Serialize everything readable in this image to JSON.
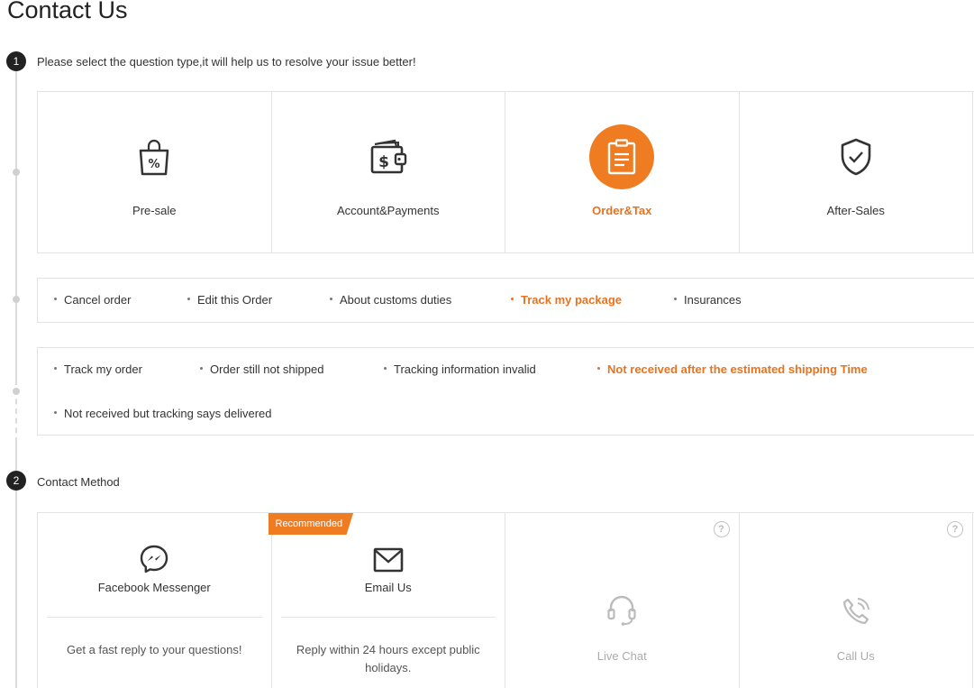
{
  "page": {
    "title": "Contact Us"
  },
  "step1": {
    "number": "1",
    "text": "Please select the question type,it will help us to resolve your issue better!"
  },
  "categories": [
    {
      "label": "Pre-sale",
      "icon": "shopping-bag-percent-icon"
    },
    {
      "label": "Account&Payments",
      "icon": "wallet-dollar-icon"
    },
    {
      "label": "Order&Tax",
      "icon": "clipboard-icon",
      "selected": true
    },
    {
      "label": "After-Sales",
      "icon": "shield-check-icon"
    }
  ],
  "order_topics": [
    {
      "label": "Cancel order"
    },
    {
      "label": "Edit this Order"
    },
    {
      "label": "About customs duties"
    },
    {
      "label": "Track my package",
      "selected": true
    },
    {
      "label": "Insurances"
    }
  ],
  "package_issues": [
    {
      "label": "Track my order"
    },
    {
      "label": "Order still not shipped"
    },
    {
      "label": "Tracking information invalid"
    },
    {
      "label": "Not received after the estimated shipping Time",
      "selected": true
    },
    {
      "label": "Not received but tracking says delivered"
    }
  ],
  "step2": {
    "number": "2",
    "text": "Contact Method"
  },
  "contact_methods": [
    {
      "title": "Facebook Messenger",
      "description": "Get a fast reply to your questions!",
      "icon": "messenger-icon"
    },
    {
      "title": "Email Us",
      "description": "Reply within 24 hours except public holidays.",
      "badge": "Recommended",
      "icon": "envelope-icon"
    },
    {
      "title": "Live Chat",
      "help": "?",
      "icon": "headset-icon",
      "disabled": true
    },
    {
      "title": "Call Us",
      "help": "?",
      "icon": "phone-icon",
      "disabled": true
    }
  ],
  "colors": {
    "accent": "#f07c22",
    "accent_text": "#e8731f",
    "border": "#e3e3e3",
    "badge_bg": "#222222"
  }
}
